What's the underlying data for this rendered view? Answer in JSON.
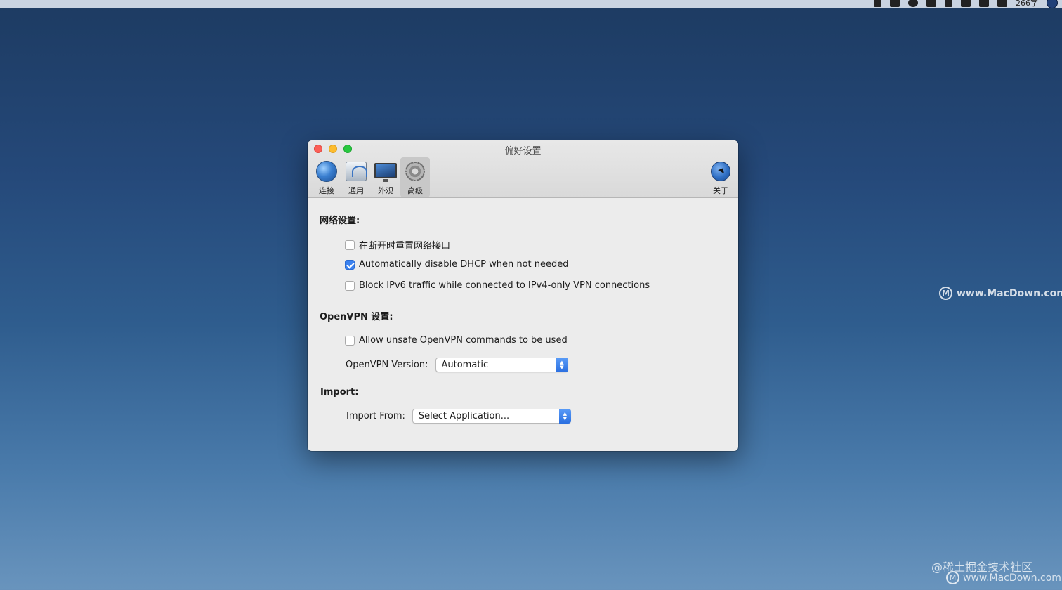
{
  "menubar": {
    "time_text": "266字"
  },
  "window": {
    "title": "偏好设置",
    "toolbar": {
      "items": [
        {
          "label": "连接"
        },
        {
          "label": "通用"
        },
        {
          "label": "外观"
        },
        {
          "label": "高级"
        }
      ],
      "about_label": "关于",
      "selected": "高级"
    },
    "network": {
      "title": "网络设置:",
      "options": [
        {
          "label": "在断开时重置网络接口",
          "checked": false
        },
        {
          "label": "Automatically disable DHCP when not needed",
          "checked": true
        },
        {
          "label": "Block IPv6 traffic while connected to IPv4-only VPN connections",
          "checked": false
        }
      ]
    },
    "openvpn": {
      "title": "OpenVPN 设置:",
      "unsafe_label": "Allow unsafe OpenVPN commands to be used",
      "unsafe_checked": false,
      "version_label": "OpenVPN Version:",
      "version_value": "Automatic"
    },
    "import": {
      "title": "Import:",
      "from_label": "Import From:",
      "from_value": "Select Application..."
    }
  },
  "watermarks": {
    "right": "www.MacDown.com",
    "bottom_cn": "@稀土掘金技术社区",
    "bottom_en": "www.MacDown.com"
  },
  "colors": {
    "accent": "#3b82f0",
    "close": "#fc5f57",
    "minimize": "#fdbc2e",
    "maximize": "#28c840"
  }
}
